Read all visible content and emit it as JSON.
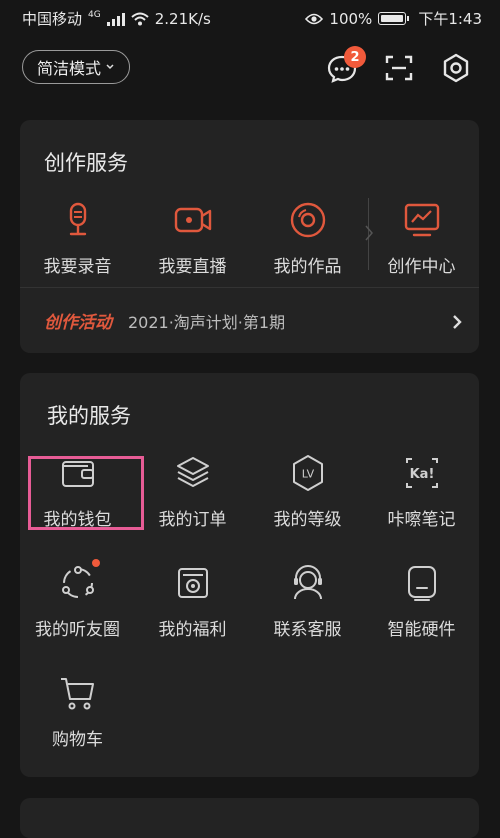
{
  "status": {
    "carrier": "中国移动",
    "network": "4G",
    "speed": "2.21K/s",
    "battery": "100%",
    "time": "下午1:43"
  },
  "topbar": {
    "mode_label": "简洁模式",
    "message_badge": "2"
  },
  "creation": {
    "title": "创作服务",
    "items": [
      {
        "label": "我要录音",
        "icon": "microphone-icon"
      },
      {
        "label": "我要直播",
        "icon": "video-camera-icon"
      },
      {
        "label": "我的作品",
        "icon": "disc-icon"
      },
      {
        "label": "创作中心",
        "icon": "monitor-chart-icon"
      }
    ],
    "activity_label": "创作活动",
    "activity_text": "2021·淘声计划·第1期"
  },
  "services": {
    "title": "我的服务",
    "items": [
      {
        "label": "我的钱包",
        "icon": "wallet-icon"
      },
      {
        "label": "我的订单",
        "icon": "layers-icon"
      },
      {
        "label": "我的等级",
        "icon": "lv-badge-icon"
      },
      {
        "label": "咔嚓笔记",
        "icon": "ka-note-icon"
      },
      {
        "label": "我的听友圈",
        "icon": "friends-circle-icon"
      },
      {
        "label": "我的福利",
        "icon": "gift-box-icon"
      },
      {
        "label": "联系客服",
        "icon": "headset-icon"
      },
      {
        "label": "智能硬件",
        "icon": "device-icon"
      },
      {
        "label": "购物车",
        "icon": "cart-icon"
      }
    ],
    "ka_text": "Ka!",
    "lv_text": "LV"
  },
  "colors": {
    "accent": "#e0583d",
    "badge": "#f15a3b",
    "highlight": "#e75c96",
    "card": "#232323",
    "background": "#161616"
  }
}
